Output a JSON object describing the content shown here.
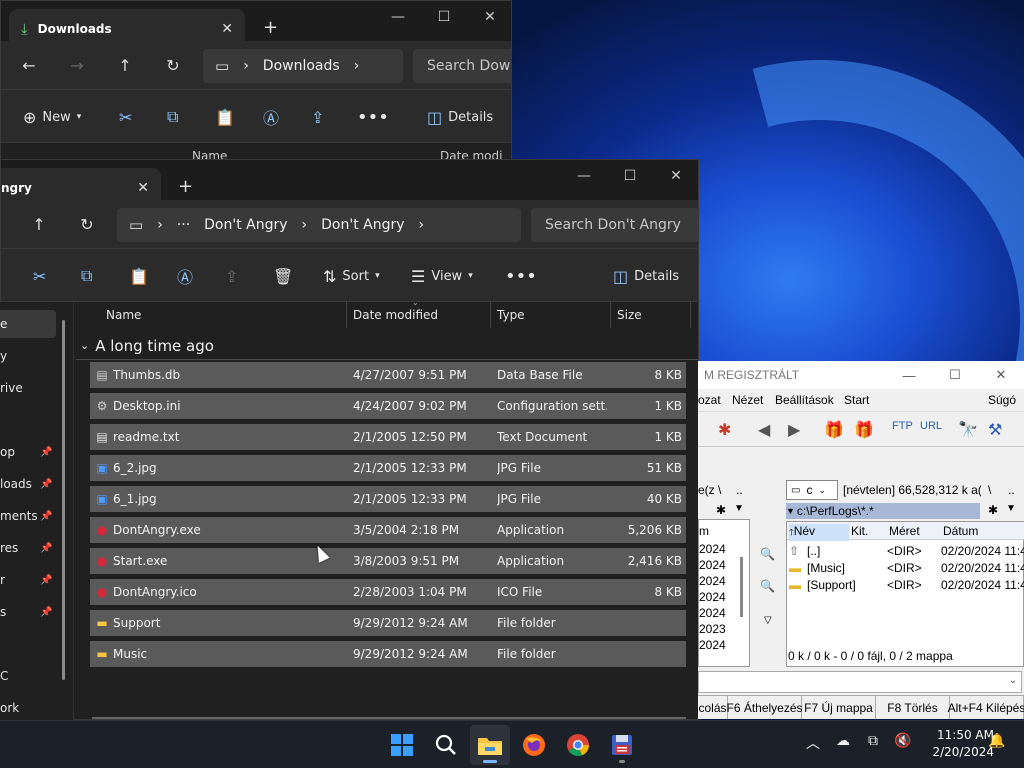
{
  "desktop": {
    "window1": {
      "tab_title": "Downloads",
      "breadcrumb": "Downloads",
      "search_placeholder": "Search Downl",
      "new_label": "New",
      "details_label": "Details",
      "col_name": "Name",
      "col_date": "Date modi"
    },
    "window2": {
      "tab_title": "ngry",
      "breadcrumb": [
        "Don't Angry",
        "Don't Angry"
      ],
      "search_placeholder": "Search Don't Angry",
      "sort_label": "Sort",
      "view_label": "View",
      "details_label": "Details",
      "columns": {
        "name": "Name",
        "date": "Date modified",
        "type": "Type",
        "size": "Size"
      },
      "group_label": "A long time ago",
      "sidebar": [
        "e",
        "y",
        "rive",
        "op",
        "loads",
        "ments",
        "res",
        "r",
        "s",
        "C",
        "ork"
      ],
      "files": [
        {
          "name": "Thumbs.db",
          "date": "4/27/2007 9:51 PM",
          "type": "Data Base File",
          "size": "8 KB",
          "icon": "db"
        },
        {
          "name": "Desktop.ini",
          "date": "4/24/2007 9:02 PM",
          "type": "Configuration sett...",
          "size": "1 KB",
          "icon": "ini"
        },
        {
          "name": "readme.txt",
          "date": "2/1/2005 12:50 PM",
          "type": "Text Document",
          "size": "1 KB",
          "icon": "txt"
        },
        {
          "name": "6_2.jpg",
          "date": "2/1/2005 12:33 PM",
          "type": "JPG File",
          "size": "51 KB",
          "icon": "jpg"
        },
        {
          "name": "6_1.jpg",
          "date": "2/1/2005 12:33 PM",
          "type": "JPG File",
          "size": "40 KB",
          "icon": "jpg"
        },
        {
          "name": "DontAngry.exe",
          "date": "3/5/2004 2:18 PM",
          "type": "Application",
          "size": "5,206 KB",
          "icon": "app"
        },
        {
          "name": "Start.exe",
          "date": "3/8/2003 9:51 PM",
          "type": "Application",
          "size": "2,416 KB",
          "icon": "app"
        },
        {
          "name": "DontAngry.ico",
          "date": "2/28/2003 1:04 PM",
          "type": "ICO File",
          "size": "8 KB",
          "icon": "app"
        },
        {
          "name": "Support",
          "date": "9/29/2012 9:24 AM",
          "type": "File folder",
          "size": "",
          "icon": "folder"
        },
        {
          "name": "Music",
          "date": "9/29/2012 9:24 AM",
          "type": "File folder",
          "size": "",
          "icon": "folder"
        }
      ]
    },
    "totalcmd": {
      "title": "M REGISZTRÁLT",
      "menu": [
        "ozat",
        "Nézet",
        "Beállítások",
        "Start",
        "Súgó"
      ],
      "drive": "c",
      "drive_info": "[névtelen]  66,528,312 k a(z",
      "path": "c:\\PerfLogs\\*.*",
      "left_path_frag": "e(z",
      "cols": [
        "Név",
        "Kit.",
        "Méret",
        "Dátum"
      ],
      "left_col": "m",
      "left_dates": [
        "2024",
        "2024",
        "2024",
        "2024",
        "2024",
        "2023",
        "2024"
      ],
      "entries": [
        {
          "name": "[..]",
          "size": "<DIR>",
          "date": "02/20/2024 11:4"
        },
        {
          "name": "[Music]",
          "size": "<DIR>",
          "date": "02/20/2024 11:4"
        },
        {
          "name": "[Support]",
          "size": "<DIR>",
          "date": "02/20/2024 11:4"
        }
      ],
      "status": "0 k / 0 k - 0 / 0 fájl, 0 / 2 mappa",
      "fkeys": [
        "colás",
        "F6 Áthelyezés",
        "F7 Új mappa",
        "F8 Törlés",
        "Alt+F4 Kilépés"
      ]
    }
  },
  "taskbar": {
    "time": "11:50 AM",
    "date": "2/20/2024"
  }
}
